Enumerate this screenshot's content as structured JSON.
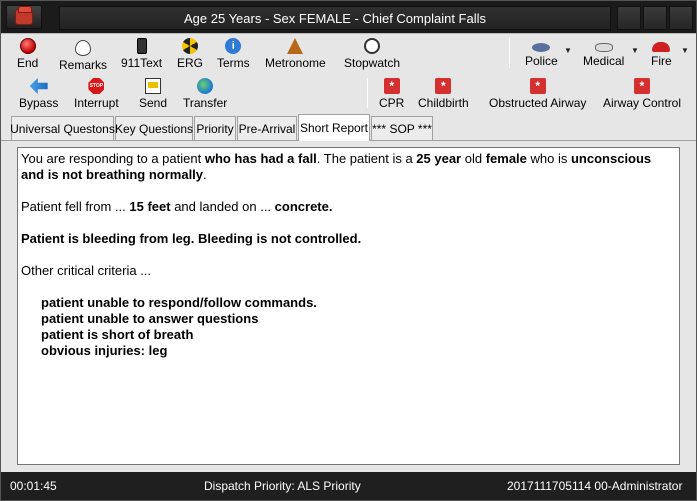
{
  "window": {
    "title": "Age 25 Years - Sex FEMALE - Chief Complaint Falls"
  },
  "toolbar": {
    "row1": [
      {
        "label": "End",
        "icon": "end-icon"
      },
      {
        "label": "Remarks",
        "icon": "speech-bubble-icon"
      },
      {
        "label": "911Text",
        "icon": "phone-icon"
      },
      {
        "label": "ERG",
        "icon": "radiation-icon"
      },
      {
        "label": "Terms",
        "icon": "info-icon"
      },
      {
        "label": "Metronome",
        "icon": "metronome-icon"
      },
      {
        "label": "Stopwatch",
        "icon": "stopwatch-icon"
      }
    ],
    "agencies": [
      {
        "label": "Police",
        "icon": "police-hat-icon"
      },
      {
        "label": "Medical",
        "icon": "medical-hat-icon"
      },
      {
        "label": "Fire",
        "icon": "fire-helmet-icon"
      }
    ],
    "row2": [
      {
        "label": "Bypass",
        "icon": "arrow-icon"
      },
      {
        "label": "Interrupt",
        "icon": "stop-sign-icon"
      },
      {
        "label": "Send",
        "icon": "send-icon"
      },
      {
        "label": "Transfer",
        "icon": "globe-icon"
      }
    ],
    "protocols": [
      {
        "label": "CPR",
        "icon": "medical-cross-icon"
      },
      {
        "label": "Childbirth",
        "icon": "medical-cross-icon"
      },
      {
        "label": "Obstructed Airway",
        "icon": "medical-cross-icon"
      },
      {
        "label": "Airway Control",
        "icon": "medical-cross-icon"
      }
    ],
    "interrupt_icon_text": "STOP"
  },
  "tabs": [
    {
      "label": "Universal Questons",
      "active": false
    },
    {
      "label": "Key Questions",
      "active": false
    },
    {
      "label": "Priority",
      "active": false
    },
    {
      "label": "Pre-Arrival",
      "active": false
    },
    {
      "label": "Short Report",
      "active": true
    },
    {
      "label": "*** SOP ***",
      "active": false
    }
  ],
  "report": {
    "line1_a": "You are responding to a patient ",
    "line1_b": "who has had a fall",
    "line1_c": ".  The patient is a ",
    "line1_d": "25 year",
    "line1_e": " old ",
    "line1_f": "female",
    "line1_g": " who is ",
    "line1_h": "unconscious and is not breathing normally",
    "line1_i": ".",
    "fall_a": "Patient fell from ... ",
    "fall_b": "15 feet",
    "fall_c": " and landed on ... ",
    "fall_d": "concrete.",
    "bleeding": "Patient is bleeding from leg.  Bleeding is not controlled.",
    "other": "Other critical criteria ...",
    "criteria": [
      "patient unable to respond/follow commands.",
      "patient unable to answer questions",
      "patient is short of breath",
      "obvious injuries: leg"
    ]
  },
  "status": {
    "elapsed": "00:01:45",
    "priority": "Dispatch Priority: ALS Priority",
    "case": "2017111705114 00-Administrator"
  }
}
